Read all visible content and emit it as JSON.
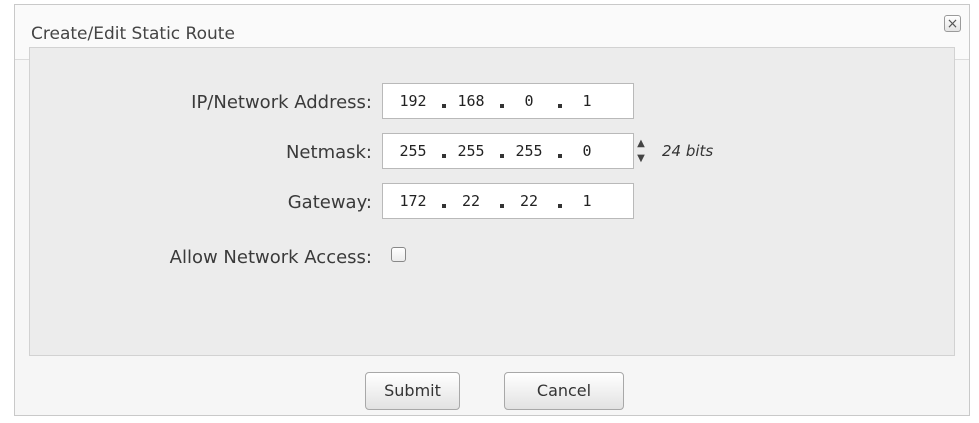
{
  "dialog": {
    "title": "Create/Edit Static Route",
    "close_label": "×"
  },
  "form": {
    "ip": {
      "label": "IP/Network Address:",
      "octets": [
        "192",
        "168",
        "0",
        "1"
      ]
    },
    "netmask": {
      "label": "Netmask:",
      "octets": [
        "255",
        "255",
        "255",
        "0"
      ],
      "spinner_up": "▲",
      "spinner_down": "▼",
      "bits_label": "24 bits"
    },
    "gateway": {
      "label": "Gateway:",
      "octets": [
        "172",
        "22",
        "22",
        "1"
      ]
    },
    "allow_network_access": {
      "label": "Allow Network Access:",
      "checked": false
    }
  },
  "buttons": {
    "submit": "Submit",
    "cancel": "Cancel"
  }
}
